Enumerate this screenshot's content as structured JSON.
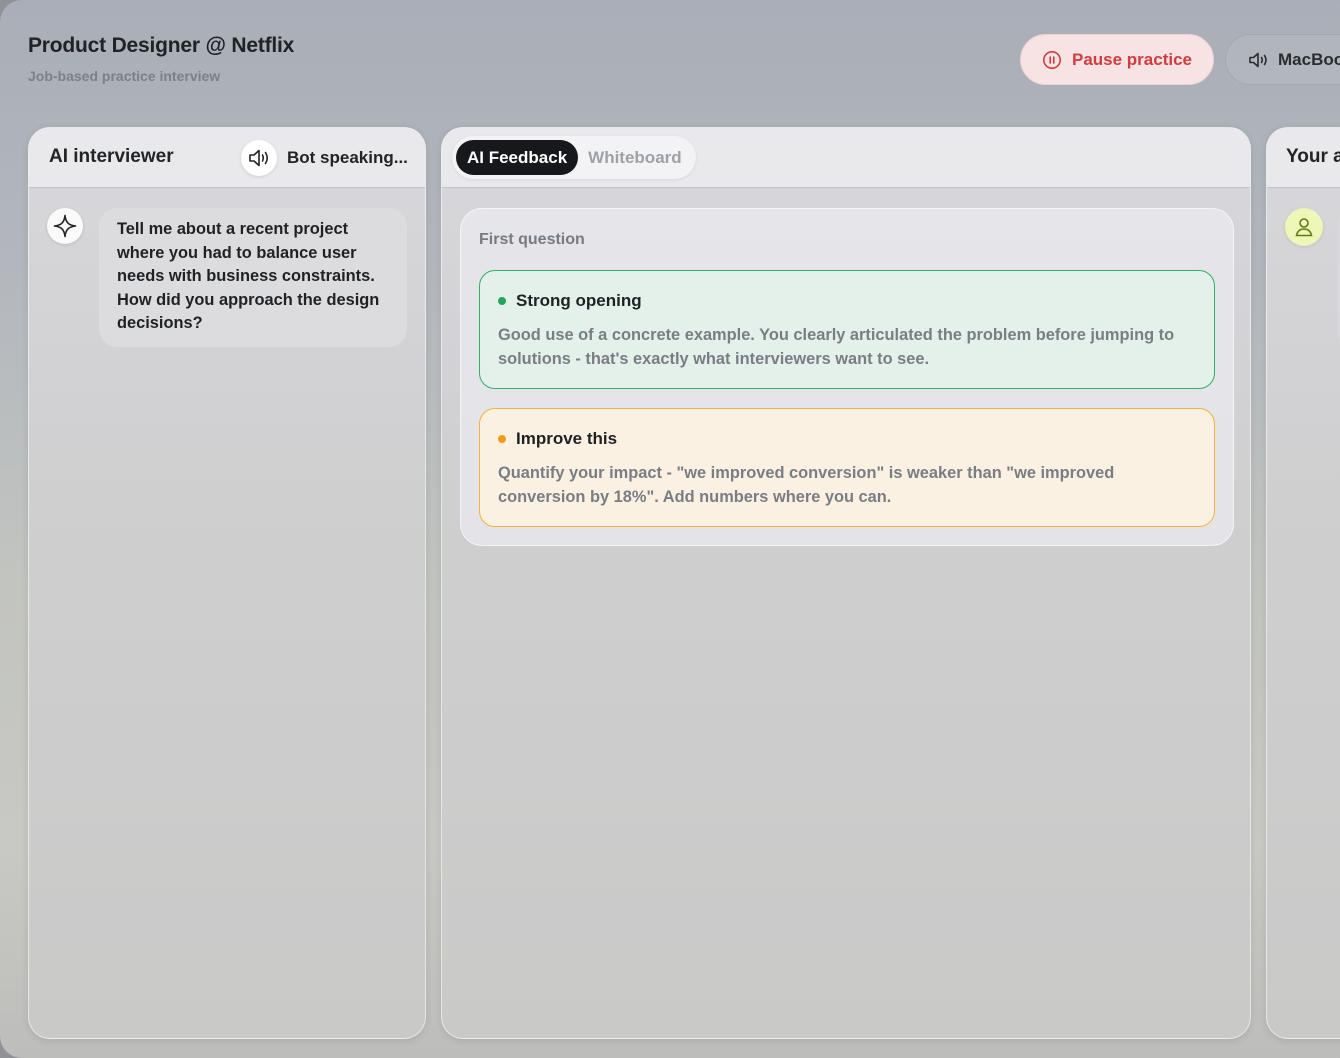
{
  "header": {
    "title": "Product Designer @ Netflix",
    "subtitle": "Job-based practice interview",
    "pause_button": "Pause practice",
    "device_button": "MacBook"
  },
  "interviewer_panel": {
    "title": "AI interviewer",
    "status": "Bot speaking...",
    "message": "Tell me about a recent project where you had to balance user needs with business constraints. How did you approach the design decisions?"
  },
  "main_panel": {
    "tabs": [
      {
        "label": "AI Feedback",
        "active": true
      },
      {
        "label": "Whiteboard",
        "active": false
      }
    ],
    "section_label": "First question",
    "feedback": [
      {
        "type": "positive",
        "title": "Strong opening",
        "body": "Good use of a concrete example. You clearly articulated the problem before jumping to solutions - that's exactly what interviewers want to see.",
        "color": "#2fb167"
      },
      {
        "type": "improve",
        "title": "Improve this",
        "body": "Quantify your impact - \"we improved conversion\" is weaker than \"we improved conversion by 18%\". Add numbers where you can.",
        "color": "#f5b23a"
      }
    ]
  },
  "answer_panel": {
    "title": "Your answer"
  },
  "icons": {
    "pause": "pause-circle-icon",
    "speaker": "speaker-icon",
    "sparkle": "sparkle-icon",
    "user": "user-icon"
  },
  "colors": {
    "pause_text": "#d33b3f",
    "positive_border": "#2fb167",
    "improve_border": "#f5b23a",
    "tab_active_bg": "#17181b"
  }
}
